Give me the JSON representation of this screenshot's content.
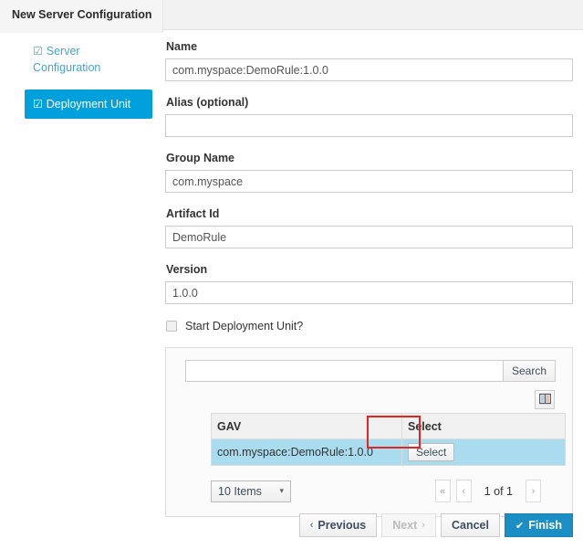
{
  "window": {
    "title": "New Server Configuration"
  },
  "sidebar": {
    "items": [
      {
        "label": "Server Configuration",
        "icon": "checked-box-icon",
        "state": "link"
      },
      {
        "label": "Deployment Unit",
        "icon": "checked-box-icon",
        "state": "active"
      }
    ]
  },
  "form": {
    "fields": [
      {
        "label": "Name",
        "value": "com.myspace:DemoRule:1.0.0",
        "placeholder": ""
      },
      {
        "label": "Alias (optional)",
        "value": "",
        "placeholder": ""
      },
      {
        "label": "Group Name",
        "value": "com.myspace",
        "placeholder": ""
      },
      {
        "label": "Artifact Id",
        "value": "DemoRule",
        "placeholder": ""
      },
      {
        "label": "Version",
        "value": "1.0.0",
        "placeholder": ""
      }
    ],
    "checkbox": {
      "label": "Start Deployment Unit?",
      "checked": false
    }
  },
  "panel": {
    "search": {
      "value": "",
      "placeholder": "",
      "button_label": "Search"
    },
    "columns_button": {
      "icon": "columns-icon",
      "label": ""
    },
    "table": {
      "columns": [
        "GAV",
        "Select"
      ],
      "rows": [
        {
          "gav": "com.myspace:DemoRule:1.0.0",
          "action_label": "Select",
          "selected": true
        }
      ]
    },
    "pagination": {
      "page_size_label": "10 Items",
      "caret_icon": "chevron-down-icon",
      "first_label": "«",
      "prev_label": "‹",
      "status": "1 of 1",
      "next_label": "›"
    }
  },
  "footer": {
    "previous": {
      "label": "Previous",
      "chevron": "‹",
      "disabled": false
    },
    "next": {
      "label": "Next",
      "chevron": "›",
      "disabled": true
    },
    "cancel": {
      "label": "Cancel"
    },
    "finish": {
      "label": "Finish",
      "check": "✔"
    }
  },
  "colors": {
    "accent_blue": "#00a0dd",
    "primary_button": "#1b8fc4",
    "row_selected": "#aadcf0",
    "highlight_red": "#e52323",
    "link_blue": "#4aa3c7"
  }
}
